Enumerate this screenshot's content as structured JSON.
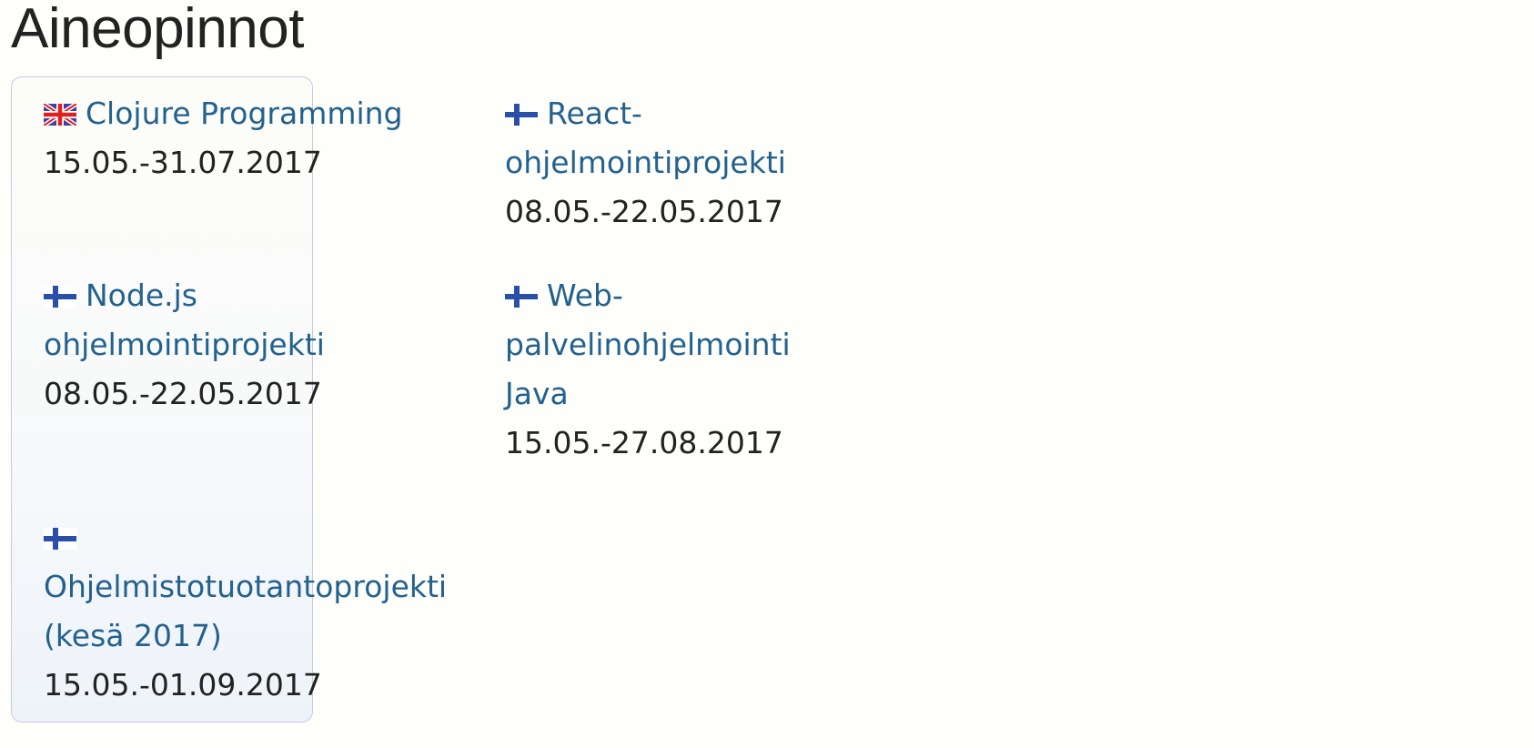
{
  "page": {
    "title": "Aineopinnot"
  },
  "courses": [
    {
      "flag_icon": "uk-flag-icon",
      "name_line1": "Clojure Programming",
      "name_line2": "",
      "name_line3": "",
      "dates": "15.05.-31.07.2017"
    },
    {
      "flag_icon": "finland-flag-icon",
      "name_line1": "React-",
      "name_line2": "ohjelmointiprojekti",
      "name_line3": "",
      "dates": "08.05.-22.05.2017"
    },
    {
      "flag_icon": "finland-flag-icon",
      "name_line1": "Node.js",
      "name_line2": "ohjelmointiprojekti",
      "name_line3": "",
      "dates": "08.05.-22.05.2017"
    },
    {
      "flag_icon": "finland-flag-icon",
      "name_line1": "Web-",
      "name_line2": "palvelinohjelmointi",
      "name_line3": "Java",
      "dates": "15.05.-27.08.2017"
    },
    {
      "flag_icon": "finland-flag-icon",
      "name_line1": "",
      "name_line2": "Ohjelmistotuotantoprojekti",
      "name_line3": "(kesä 2017)",
      "dates": "15.05.-01.09.2017"
    }
  ],
  "colors": {
    "link": "#23628f",
    "text": "#222222",
    "panel_border": "#c9c7e6",
    "background": "#fefefa"
  }
}
